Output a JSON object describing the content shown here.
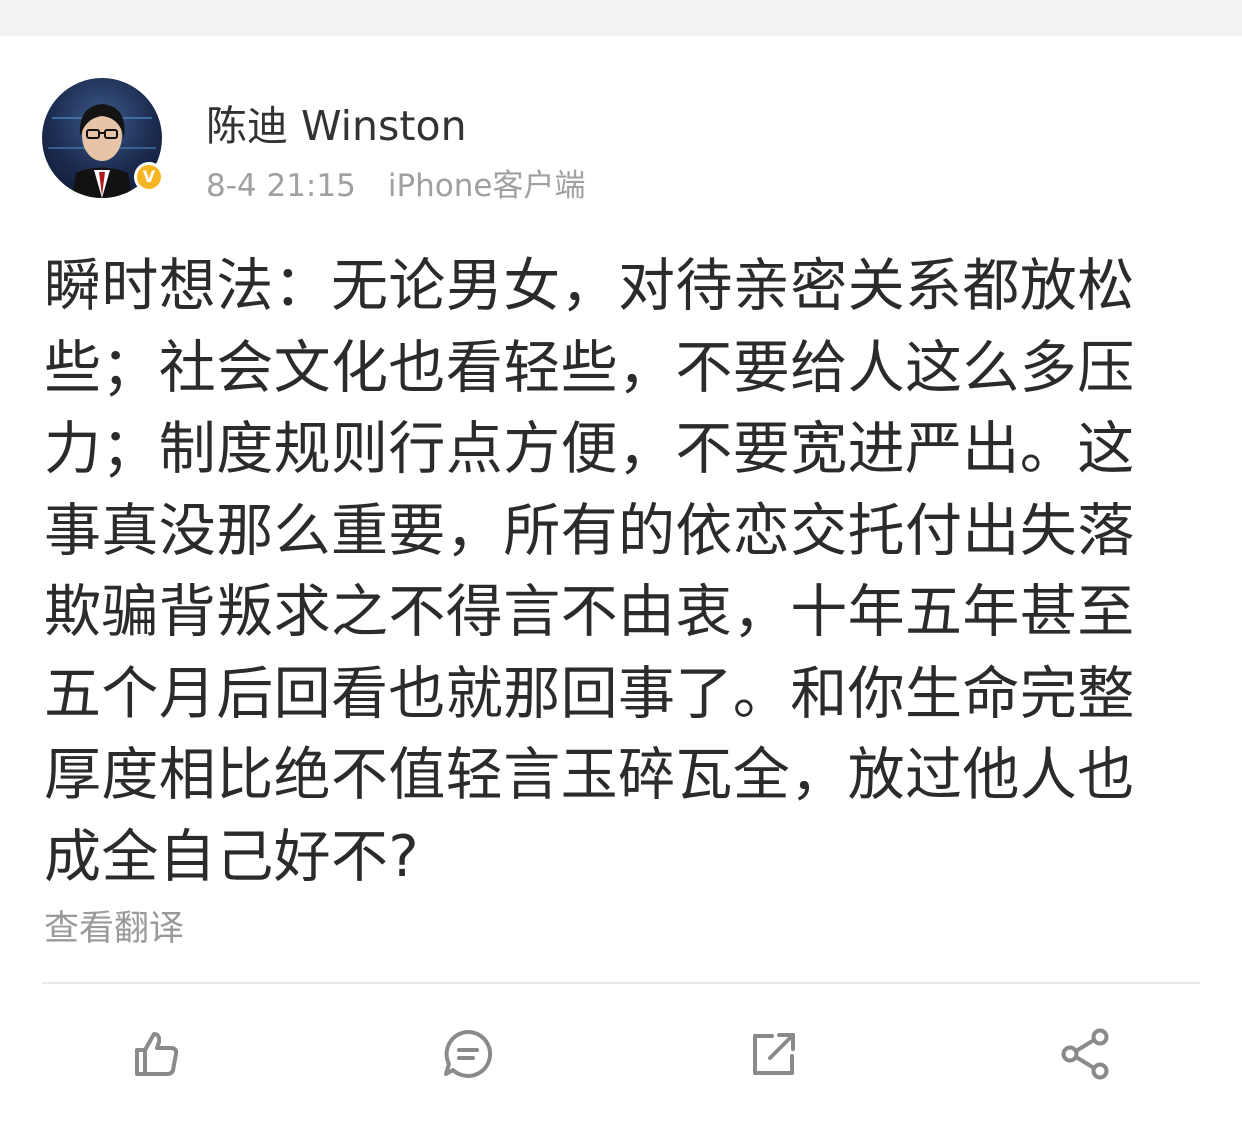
{
  "author": {
    "name": "陈迪 Winston",
    "time": "8-4 21:15",
    "source": "iPhone客户端",
    "verified_mark": "V"
  },
  "post": {
    "lines": [
      "瞬时想法：无论男女，对待亲密关系都放松",
      "些；社会文化也看轻些，不要给人这么多压",
      "力；制度规则行点方便，不要宽进严出。这",
      "事真没那么重要，所有的依恋交托付出失落",
      "欺骗背叛求之不得言不由衷，十年五年甚至",
      "五个月后回看也就那回事了。和你生命完整",
      "厚度相比绝不值轻言玉碎瓦全，放过他人也",
      "成全自己好不?"
    ],
    "translate_label": "查看翻译"
  },
  "actions": {
    "icons": [
      "thumbs-up-icon",
      "comment-icon",
      "repost-icon",
      "share-icon"
    ]
  },
  "colors": {
    "text": "#2b2b2b",
    "muted": "#a0a0a0",
    "verified": "#f6b623",
    "icon": "#8a8a8a"
  }
}
